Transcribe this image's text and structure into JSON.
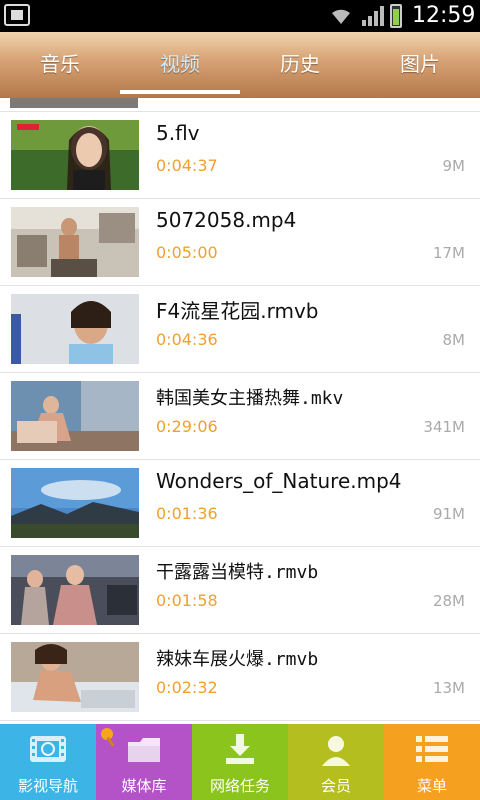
{
  "status": {
    "time": "12:59"
  },
  "tabs": [
    {
      "label": "音乐",
      "active": false
    },
    {
      "label": "视频",
      "active": true
    },
    {
      "label": "历史",
      "active": false
    },
    {
      "label": "图片",
      "active": false
    }
  ],
  "videos": [
    {
      "name": "5.flv",
      "duration": "0:04:37",
      "size": "9M"
    },
    {
      "name": "5072058.mp4",
      "duration": "0:05:00",
      "size": "17M"
    },
    {
      "name": "F4流星花园.rmvb",
      "duration": "0:04:36",
      "size": "8M"
    },
    {
      "name": " 韩国美女主播热舞.mkv",
      "duration": "0:29:06",
      "size": "341M"
    },
    {
      "name": "Wonders_of_Nature.mp4",
      "duration": "0:01:36",
      "size": "91M"
    },
    {
      "name": "干露露当模特.rmvb",
      "duration": "0:01:58",
      "size": "28M"
    },
    {
      "name": " 辣妹车展火爆.rmvb",
      "duration": "0:02:32",
      "size": "13M"
    }
  ],
  "bottom_nav": [
    {
      "label": "影视导航",
      "icon": "film-strip-icon",
      "color": "#3cb4e6"
    },
    {
      "label": "媒体库",
      "icon": "folder-icon",
      "color": "#b452c8"
    },
    {
      "label": "网络任务",
      "icon": "download-icon",
      "color": "#8cc41e"
    },
    {
      "label": "会员",
      "icon": "user-icon",
      "color": "#b4be1e"
    },
    {
      "label": "菜单",
      "icon": "menu-list-icon",
      "color": "#f5a01e"
    }
  ]
}
